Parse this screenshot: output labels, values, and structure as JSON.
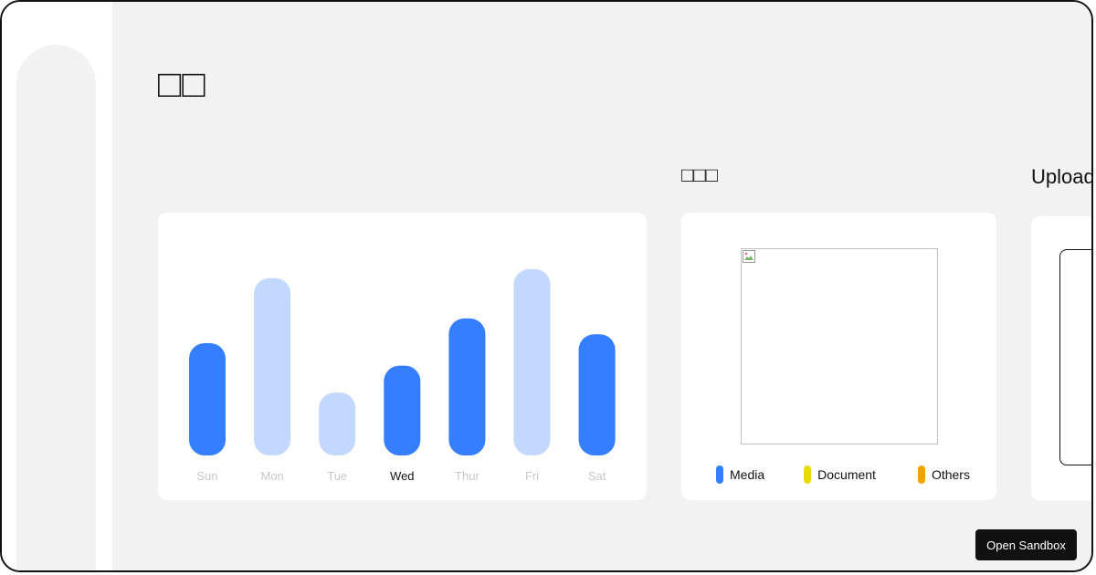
{
  "page": {
    "title": "□□"
  },
  "sections": {
    "storage_title": "□□□",
    "upload_title": "Upload"
  },
  "chart_data": {
    "type": "bar",
    "categories": [
      "Sun",
      "Mon",
      "Tue",
      "Wed",
      "Thur",
      "Fri",
      "Sat"
    ],
    "values": [
      0.5,
      0.79,
      0.28,
      0.4,
      0.61,
      0.83,
      0.54
    ],
    "active_category": "Wed",
    "highlighted": [
      true,
      false,
      false,
      true,
      true,
      false,
      true
    ],
    "title": "",
    "xlabel": "",
    "ylabel": "",
    "ylim": [
      0,
      1
    ],
    "colors": {
      "strong": "#347eff",
      "light": "#c2d8fd"
    }
  },
  "storage": {
    "legend": [
      {
        "label": "Media",
        "color": "#347eff"
      },
      {
        "label": "Document",
        "color": "#e8dc0c"
      },
      {
        "label": "Others",
        "color": "#f5a10c"
      }
    ]
  },
  "actions": {
    "open_sandbox_label": "Open Sandbox"
  }
}
